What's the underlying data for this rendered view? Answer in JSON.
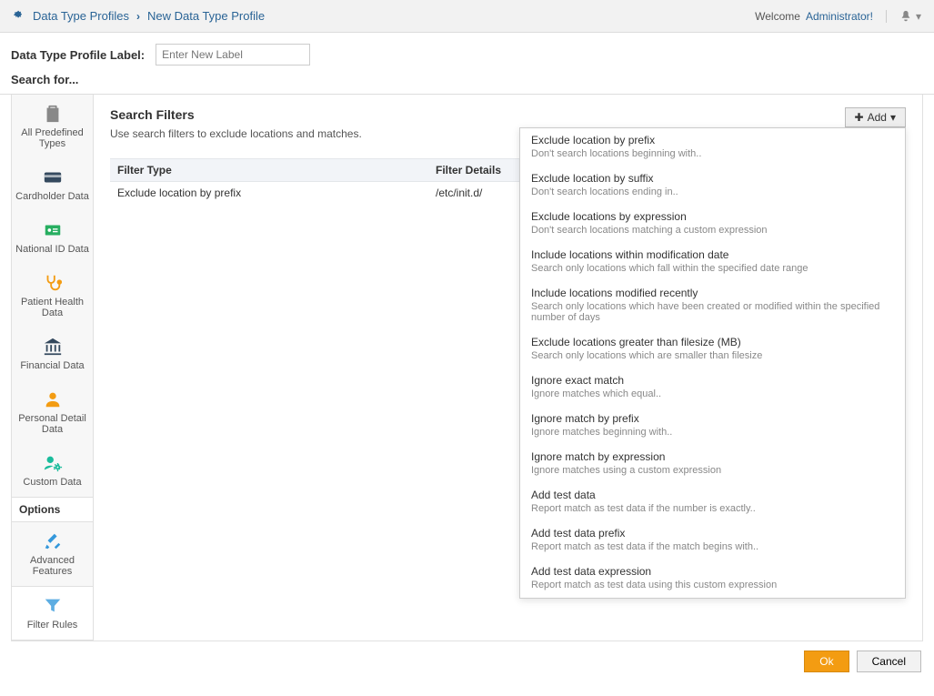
{
  "breadcrumb": {
    "parent": "Data Type Profiles",
    "current": "New Data Type Profile"
  },
  "welcome": {
    "prefix": "Welcome",
    "user": "Administrator!"
  },
  "label_row": {
    "label": "Data Type Profile Label:",
    "placeholder": "Enter New Label"
  },
  "searchfor": "Search for...",
  "sidebar": {
    "items": [
      {
        "label": "All Predefined Types"
      },
      {
        "label": "Cardholder Data"
      },
      {
        "label": "National ID Data"
      },
      {
        "label": "Patient Health Data"
      },
      {
        "label": "Financial Data"
      },
      {
        "label": "Personal Detail Data"
      },
      {
        "label": "Custom Data"
      }
    ],
    "options_header": "Options",
    "options": [
      {
        "label": "Advanced Features"
      },
      {
        "label": "Filter Rules"
      }
    ]
  },
  "main": {
    "title": "Search Filters",
    "subtitle": "Use search filters to exclude locations and matches.",
    "add_label": "Add",
    "columns": {
      "type": "Filter Type",
      "details": "Filter Details"
    },
    "rows": [
      {
        "type": "Exclude location by prefix",
        "details": "/etc/init.d/"
      }
    ]
  },
  "dropdown": [
    {
      "t": "Exclude location by prefix",
      "d": "Don't search locations beginning with.."
    },
    {
      "t": "Exclude location by suffix",
      "d": "Don't search locations ending in.."
    },
    {
      "t": "Exclude locations by expression",
      "d": "Don't search locations matching a custom expression"
    },
    {
      "t": "Include locations within modification date",
      "d": "Search only locations which fall within the specified date range"
    },
    {
      "t": "Include locations modified recently",
      "d": "Search only locations which have been created or modified within the specified number of days"
    },
    {
      "t": "Exclude locations greater than filesize (MB)",
      "d": "Search only locations which are smaller than filesize"
    },
    {
      "t": "Ignore exact match",
      "d": "Ignore matches which equal.."
    },
    {
      "t": "Ignore match by prefix",
      "d": "Ignore matches beginning with.."
    },
    {
      "t": "Ignore match by expression",
      "d": "Ignore matches using a custom expression"
    },
    {
      "t": "Add test data",
      "d": "Report match as test data if the number is exactly.."
    },
    {
      "t": "Add test data prefix",
      "d": "Report match as test data if the match begins with.."
    },
    {
      "t": "Add test data expression",
      "d": "Report match as test data using this custom expression"
    }
  ],
  "footer": {
    "ok": "Ok",
    "cancel": "Cancel"
  }
}
